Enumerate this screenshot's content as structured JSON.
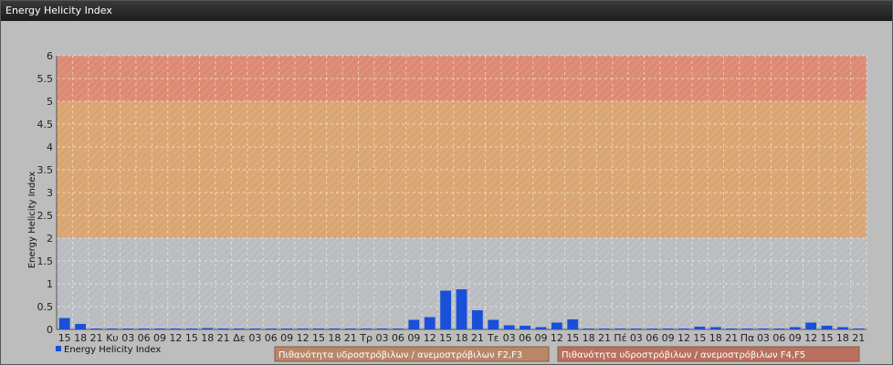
{
  "window": {
    "title": "Energy Helicity Index"
  },
  "chart_data": {
    "type": "bar",
    "ylabel": "Energy Helicity Index",
    "ylim": [
      0,
      6
    ],
    "yticks": [
      "0",
      "0.5",
      "1",
      "1.5",
      "2",
      "2.5",
      "3",
      "3.5",
      "4",
      "4.5",
      "5",
      "5.5",
      "6"
    ],
    "categories": [
      "15",
      "18",
      "21",
      "Κυ",
      "03",
      "06",
      "09",
      "12",
      "15",
      "18",
      "21",
      "Δε",
      "03",
      "06",
      "09",
      "12",
      "15",
      "18",
      "21",
      "Τρ",
      "03",
      "06",
      "09",
      "12",
      "15",
      "18",
      "21",
      "Τε",
      "03",
      "06",
      "09",
      "12",
      "15",
      "18",
      "21",
      "Πέ",
      "03",
      "06",
      "09",
      "12",
      "15",
      "18",
      "21",
      "Πα",
      "03",
      "06",
      "09",
      "12",
      "15",
      "18",
      "21"
    ],
    "series": [
      {
        "name": "Energy Helicity Index",
        "color": "#1a4fd8",
        "values": [
          0.25,
          0.12,
          0.02,
          0.02,
          0.02,
          0.02,
          0.02,
          0.02,
          0.02,
          0.03,
          0.02,
          0.02,
          0.02,
          0.02,
          0.02,
          0.02,
          0.02,
          0.02,
          0.02,
          0.02,
          0.02,
          0.02,
          0.21,
          0.27,
          0.85,
          0.88,
          0.42,
          0.21,
          0.09,
          0.08,
          0.05,
          0.15,
          0.22,
          0.02,
          0.02,
          0.02,
          0.02,
          0.02,
          0.02,
          0.02,
          0.06,
          0.05,
          0.02,
          0.02,
          0.02,
          0.02,
          0.05,
          0.15,
          0.08,
          0.05,
          0.02
        ]
      }
    ],
    "bands": [
      {
        "from": 0,
        "to": 2,
        "color": "#b9bcc0"
      },
      {
        "from": 2,
        "to": 5,
        "color": "#daa572"
      },
      {
        "from": 5,
        "to": 6,
        "color": "#dd8a73"
      }
    ],
    "grid": true,
    "legend": {
      "series_label": "Energy Helicity Index",
      "zones": [
        {
          "label": "Πιθανότητα υδροστρόβιλων / ανεμοστρόβιλων F2,F3",
          "color": "#b8876a"
        },
        {
          "label": "Πιθανότητα υδροστρόβιλων / ανεμοστρόβιλων F4,F5",
          "color": "#b8715f"
        }
      ]
    }
  }
}
